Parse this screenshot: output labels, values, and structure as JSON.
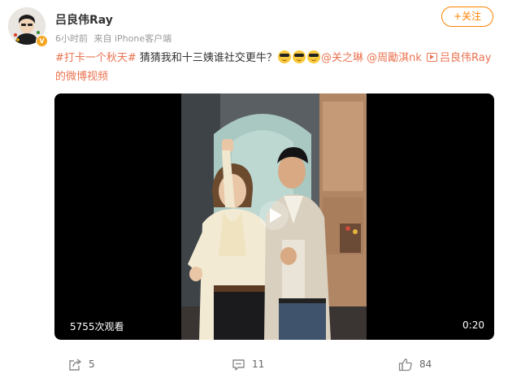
{
  "post": {
    "author": "吕良伟Ray",
    "time": "6小时前",
    "source": "来自 iPhone客户端",
    "follow_label": "+关注",
    "verified_badge": "V",
    "content": {
      "hashtag": "#打卡一个秋天#",
      "text": " 猜猜我和十三姨谁社交更牛？",
      "mention1": "@关之琳",
      "mention2": "@周勵淇nk",
      "video_link": "吕良伟Ray的微博视频"
    },
    "video": {
      "views": "5755次观看",
      "duration": "0:20"
    },
    "actions": {
      "repost_count": "5",
      "comment_count": "11",
      "like_count": "84"
    }
  },
  "icons": {
    "emoji": "sunglasses-emoji",
    "repost": "repost-icon",
    "comment": "comment-icon",
    "like": "thumbs-up-icon",
    "play": "play-icon",
    "video": "video-camera-icon"
  },
  "colors": {
    "accent": "#ff8200",
    "link": "#eb7350",
    "badge": "#f5a623",
    "muted": "#999999"
  }
}
